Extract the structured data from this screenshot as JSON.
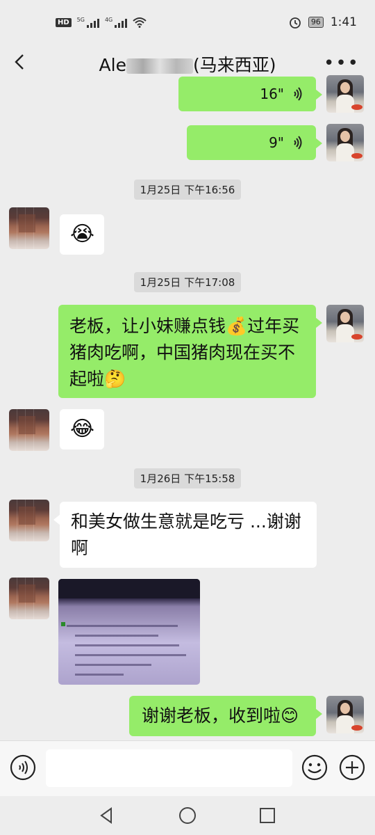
{
  "status_bar": {
    "hd": "HD",
    "net1": "5G",
    "net2": "4G",
    "battery": "96",
    "time": "1:41"
  },
  "header": {
    "title_prefix": "Ale",
    "title_suffix": "(马来西亚)",
    "more": "•••"
  },
  "messages": [
    {
      "type": "voice",
      "side": "me",
      "duration": "16\""
    },
    {
      "type": "voice",
      "side": "me",
      "duration": "9\""
    },
    {
      "type": "time",
      "text": "1月25日 下午16:56"
    },
    {
      "type": "emoji",
      "side": "other",
      "emoji": "😭"
    },
    {
      "type": "time",
      "text": "1月25日 下午17:08"
    },
    {
      "type": "text",
      "side": "me",
      "text": "老板，让小妹赚点钱💰过年买猪肉吃啊，中国猪肉现在买不起啦🤔"
    },
    {
      "type": "emoji",
      "side": "other",
      "emoji": "😂"
    },
    {
      "type": "time",
      "text": "1月26日 下午15:58"
    },
    {
      "type": "text",
      "side": "other",
      "text": "和美女做生意就是吃亏 ...谢谢啊"
    },
    {
      "type": "image",
      "side": "other"
    },
    {
      "type": "text",
      "side": "me",
      "text": "谢谢老板，收到啦😊"
    }
  ],
  "input_bar": {
    "placeholder": ""
  },
  "colors": {
    "bubble_me": "#95ec69",
    "bubble_other": "#ffffff",
    "background": "#ededed"
  }
}
